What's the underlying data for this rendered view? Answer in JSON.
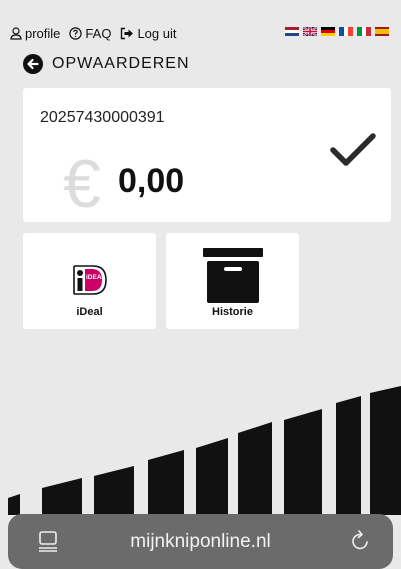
{
  "nav": {
    "profile": "profile",
    "faq": "FAQ",
    "logout": "Log uit"
  },
  "languages": [
    "nl",
    "en",
    "de",
    "fr",
    "it",
    "es"
  ],
  "page": {
    "title": "OPWAARDEREN"
  },
  "card": {
    "number": "20257430000391",
    "currency_symbol": "€",
    "balance": "0,00"
  },
  "actions": {
    "ideal_label": "iDeal",
    "ideal_logo_text": "iDEAL",
    "history_label": "Historie"
  },
  "browser": {
    "url": "mijnkniponline.nl"
  },
  "colors": {
    "background": "#e9e9e9",
    "ideal_pink": "#cc0066",
    "urlbar": "#6b6b6b"
  }
}
